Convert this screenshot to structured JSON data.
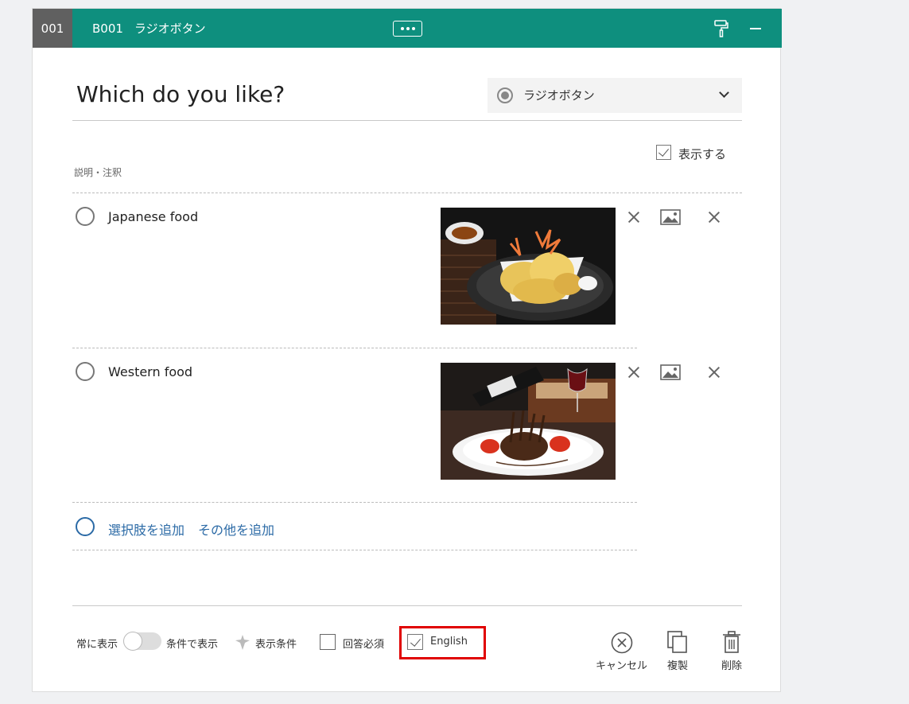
{
  "header": {
    "number": "001",
    "code": "B001",
    "type_name": "ラジオボタン"
  },
  "question": {
    "title": "Which do you like?",
    "type_select": "ラジオボタン",
    "show_label": "表示する",
    "desc_label": "説明・注釈"
  },
  "choices": [
    {
      "label": "Japanese food"
    },
    {
      "label": "Western food"
    }
  ],
  "add": {
    "add_choice": "選択肢を追加",
    "add_other": "その他を追加"
  },
  "footer": {
    "always_show": "常に表示",
    "conditional_show": "条件で表示",
    "display_condition": "表示条件",
    "required": "回答必須",
    "english": "English",
    "cancel": "キャンセル",
    "duplicate": "複製",
    "delete": "削除"
  },
  "colors": {
    "header_bg": "#0e8f7e",
    "number_bg": "#606060",
    "link": "#2b6aa6",
    "highlight": "#e00000"
  }
}
